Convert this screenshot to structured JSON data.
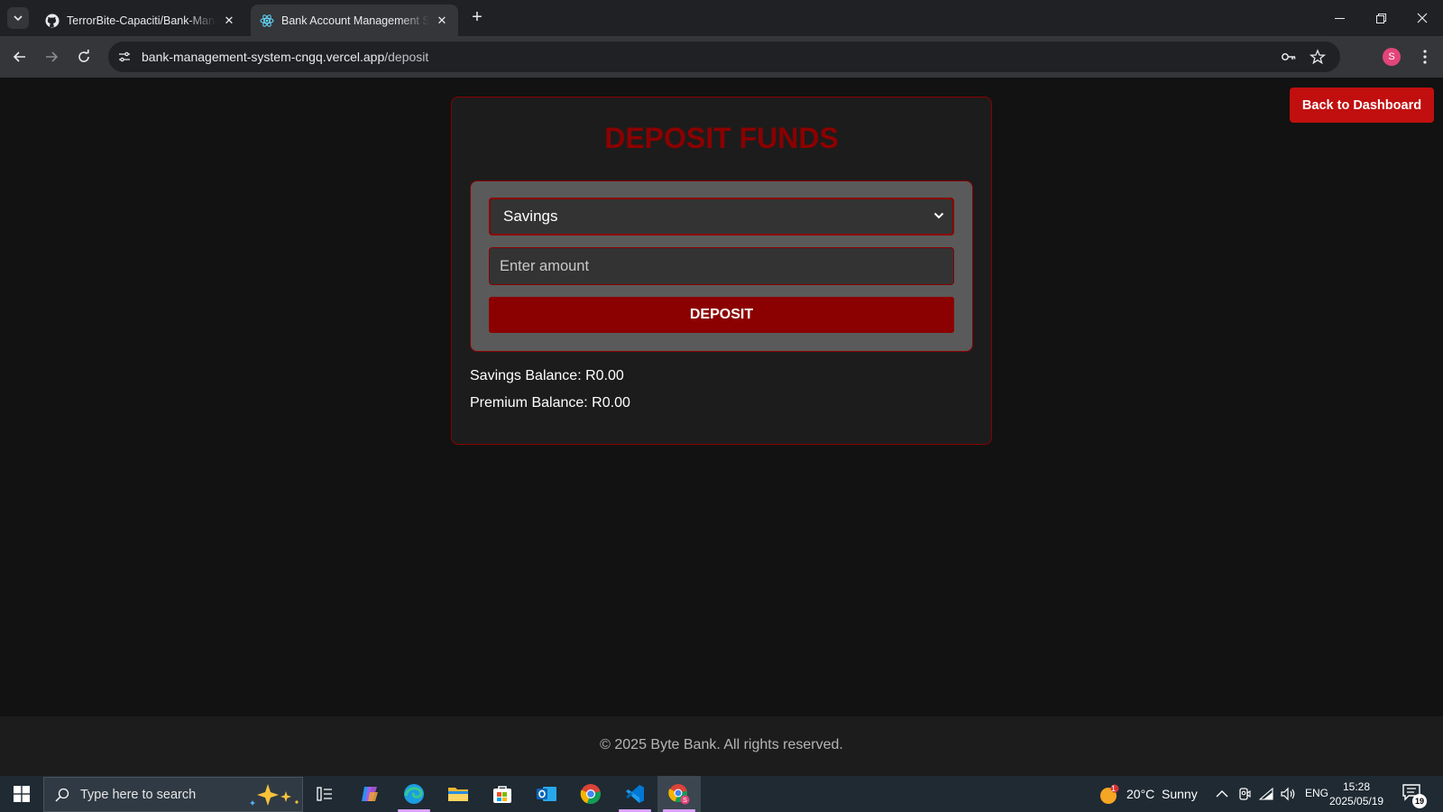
{
  "browser": {
    "tabs": [
      {
        "title": "TerrorBite-Capaciti/Bank-Management-System",
        "favicon": "github-icon",
        "active": false
      },
      {
        "title": "Bank Account Management System",
        "favicon": "react-icon",
        "active": true
      }
    ],
    "url_host": "bank-management-system-cngq.vercel.app",
    "url_path": "/deposit",
    "profile_initial": "S"
  },
  "page": {
    "back_button": "Back to Dashboard",
    "title": "DEPOSIT FUNDS",
    "account_select": {
      "value": "Savings"
    },
    "amount_input": {
      "placeholder": "Enter amount"
    },
    "deposit_button": "DEPOSIT",
    "balances": [
      {
        "label": "Savings Balance: R0.00"
      },
      {
        "label": "Premium Balance: R0.00"
      }
    ],
    "footer": "© 2025 Byte Bank. All rights reserved."
  },
  "colors": {
    "accent_dark_red": "#8b0000",
    "button_red": "#c10f0f",
    "background": "#121212"
  },
  "taskbar": {
    "search_placeholder": "Type here to search",
    "apps": [
      "task-view-icon",
      "copilot-icon",
      "edge-icon",
      "file-explorer-icon",
      "store-icon",
      "outlook-icon",
      "chrome-icon",
      "vscode-icon",
      "chrome-profile-icon"
    ],
    "weather": {
      "temp": "20°C",
      "condition": "Sunny",
      "alert_count": "1"
    },
    "language": "ENG",
    "time": "15:28",
    "date": "2025/05/19",
    "notifications": "19"
  }
}
